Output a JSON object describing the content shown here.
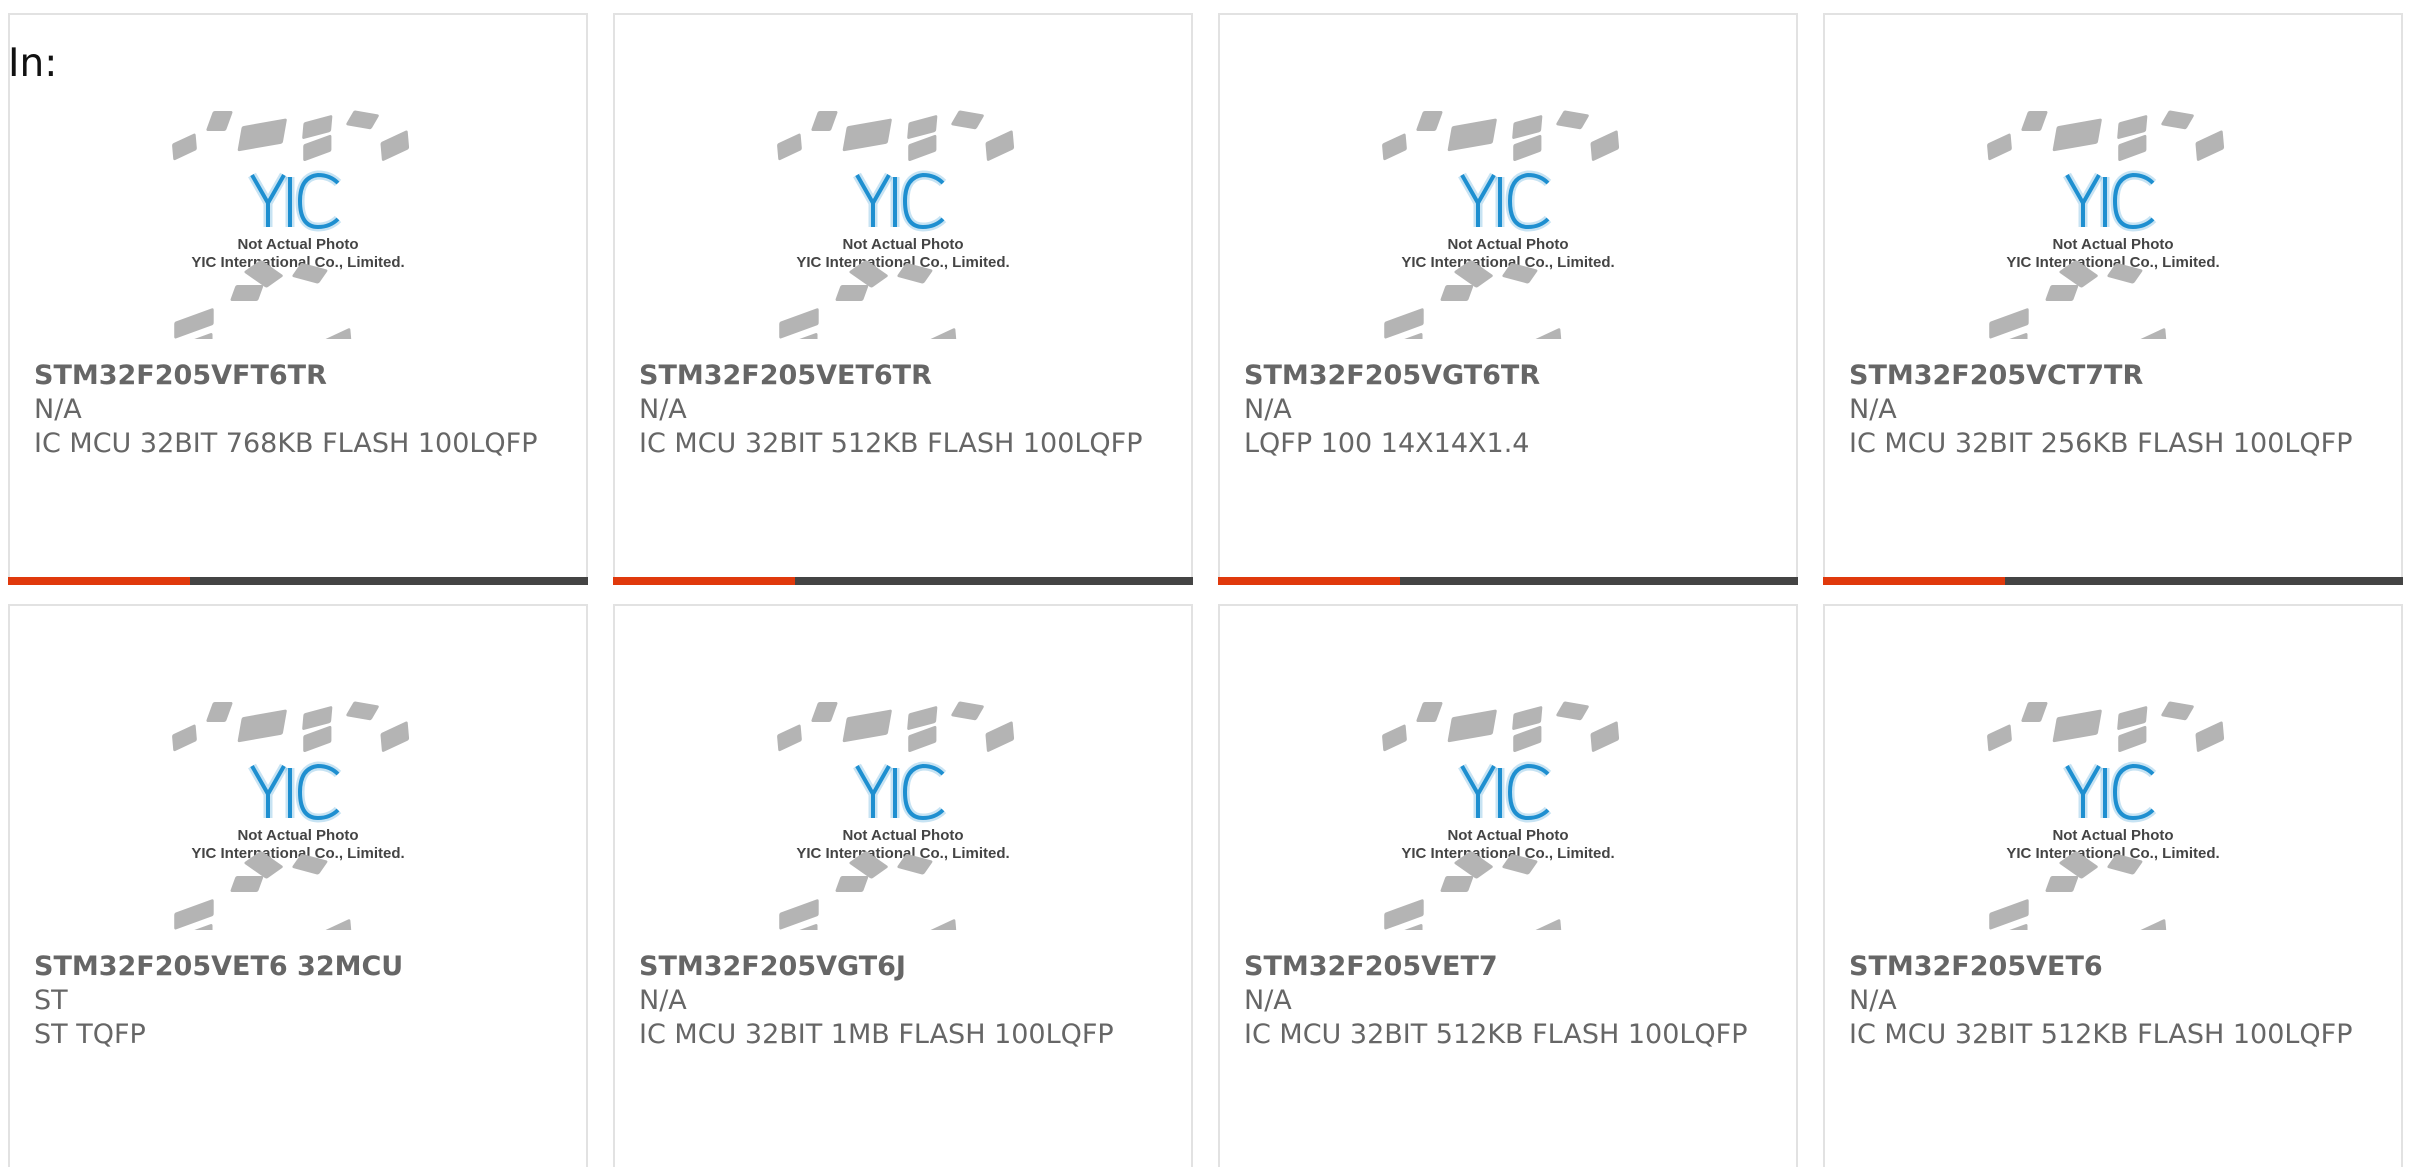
{
  "header": {
    "label": "In:"
  },
  "theme": {
    "accent": "#e0390c",
    "bar": "#444444",
    "logo": "#1e8fd0",
    "chip": "#b4b4b4"
  },
  "thumbnail": {
    "caption_line1": "Not Actual Photo",
    "caption_line2": "YIC International Co., Limited.",
    "logo_text": "YIC"
  },
  "products": [
    {
      "part": "STM32F205VFT6TR",
      "brand": "N/A",
      "desc": "IC MCU 32BIT 768KB FLASH 100LQFP"
    },
    {
      "part": "STM32F205VET6TR",
      "brand": "N/A",
      "desc": "IC MCU 32BIT 512KB FLASH 100LQFP"
    },
    {
      "part": "STM32F205VGT6TR",
      "brand": "N/A",
      "desc": "LQFP 100 14X14X1.4"
    },
    {
      "part": "STM32F205VCT7TR",
      "brand": "N/A",
      "desc": "IC MCU 32BIT 256KB FLASH 100LQFP"
    },
    {
      "part": "STM32F205VET6 32MCU",
      "brand": "ST",
      "desc": "ST TQFP"
    },
    {
      "part": "STM32F205VGT6J",
      "brand": "N/A",
      "desc": "IC MCU 32BIT 1MB FLASH 100LQFP"
    },
    {
      "part": "STM32F205VET7",
      "brand": "N/A",
      "desc": "IC MCU 32BIT 512KB FLASH 100LQFP"
    },
    {
      "part": "STM32F205VET6",
      "brand": "N/A",
      "desc": "IC MCU 32BIT 512KB FLASH 100LQFP"
    }
  ]
}
